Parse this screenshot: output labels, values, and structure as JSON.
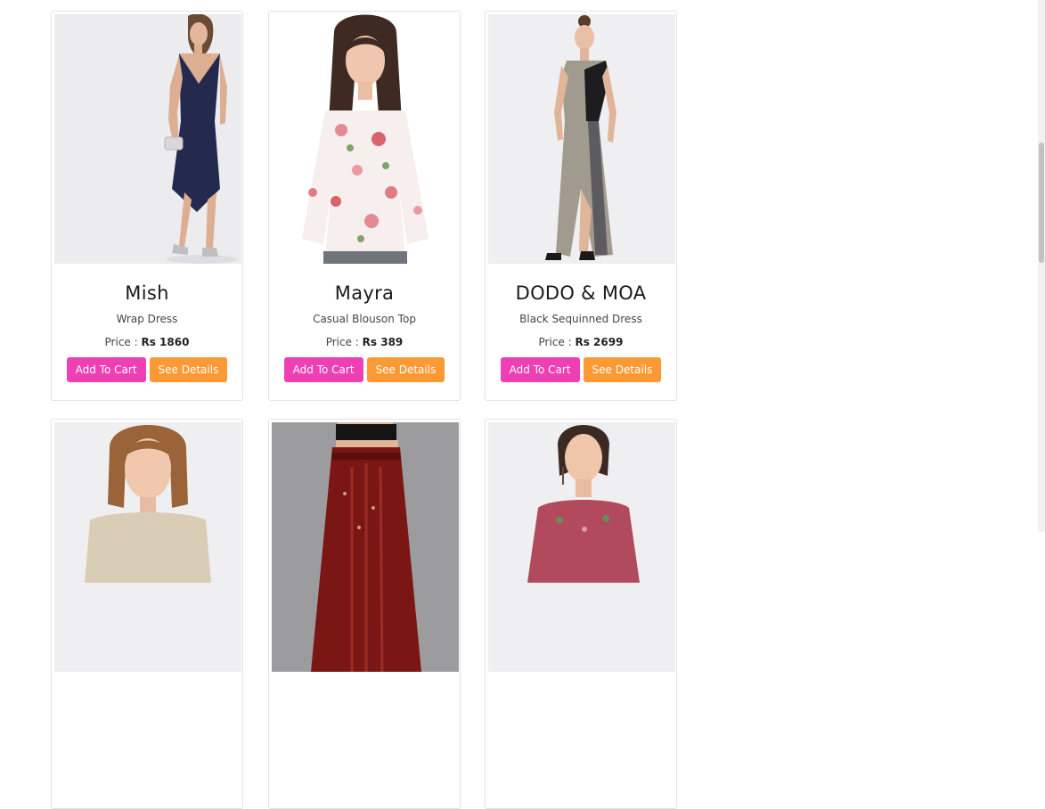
{
  "labels": {
    "add_to_cart": "Add To Cart",
    "see_details": "See Details",
    "price_prefix": "Price : "
  },
  "products": [
    {
      "brand": "Mish",
      "name": "Wrap Dress",
      "price": "Rs 1860",
      "image": "navy-wrap-dress-photo"
    },
    {
      "brand": "Mayra",
      "name": "Casual Blouson Top",
      "price": "Rs 389",
      "image": "floral-blouson-top-photo"
    },
    {
      "brand": "DODO & MOA",
      "name": "Black Sequinned Dress",
      "price": "Rs 2699",
      "image": "silver-sequinned-dress-photo"
    },
    {
      "image": "sequin-top-photo"
    },
    {
      "image": "red-printed-skirt-photo"
    },
    {
      "image": "pink-printed-top-photo"
    }
  ],
  "colors": {
    "add_to_cart": "#ee3fb3",
    "see_details": "#fb9a35"
  }
}
